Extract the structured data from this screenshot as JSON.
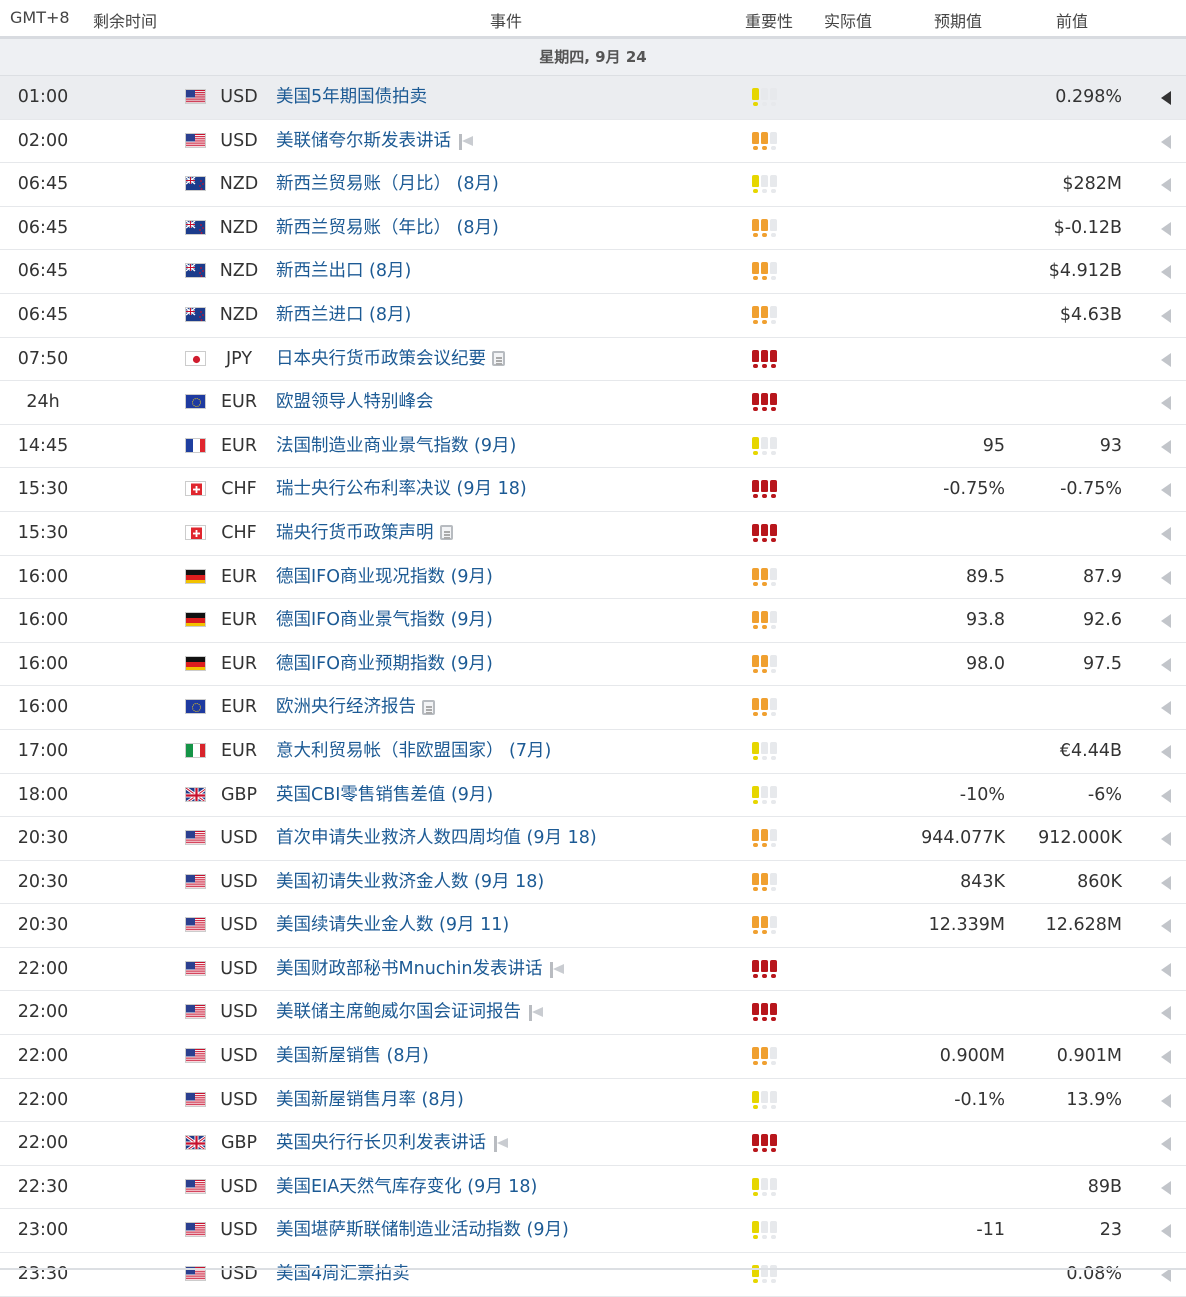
{
  "header": {
    "timezone": "GMT+8",
    "remaining": "剩余时间",
    "event": "事件",
    "importance": "重要性",
    "actual": "实际值",
    "forecast": "预期值",
    "previous": "前值"
  },
  "day_label": "星期四, 9月 24",
  "colors": {
    "link": "#1c5a94",
    "imp_low": "#e6d600",
    "imp_medium": "#f0a030",
    "imp_high": "#b8161c",
    "header_border": "#d8dbe0"
  },
  "events": [
    {
      "time": "01:00",
      "flag": "us",
      "currency": "USD",
      "name": "美国5年期国债拍卖",
      "icon": "",
      "importance": 1,
      "actual": "",
      "forecast": "",
      "previous": "0.298%",
      "highlighted": true
    },
    {
      "time": "02:00",
      "flag": "us",
      "currency": "USD",
      "name": "美联储夸尔斯发表讲话",
      "icon": "speech-icon",
      "importance": 2,
      "actual": "",
      "forecast": "",
      "previous": ""
    },
    {
      "time": "06:45",
      "flag": "nz",
      "currency": "NZD",
      "name": "新西兰贸易账（月比） (8月)",
      "icon": "",
      "importance": 1,
      "actual": "",
      "forecast": "",
      "previous": "$282M"
    },
    {
      "time": "06:45",
      "flag": "nz",
      "currency": "NZD",
      "name": "新西兰贸易账（年比） (8月)",
      "icon": "",
      "importance": 2,
      "actual": "",
      "forecast": "",
      "previous": "$-0.12B"
    },
    {
      "time": "06:45",
      "flag": "nz",
      "currency": "NZD",
      "name": "新西兰出口 (8月)",
      "icon": "",
      "importance": 2,
      "actual": "",
      "forecast": "",
      "previous": "$4.912B"
    },
    {
      "time": "06:45",
      "flag": "nz",
      "currency": "NZD",
      "name": "新西兰进口 (8月)",
      "icon": "",
      "importance": 2,
      "actual": "",
      "forecast": "",
      "previous": "$4.63B"
    },
    {
      "time": "07:50",
      "flag": "jp",
      "currency": "JPY",
      "name": "日本央行货币政策会议纪要",
      "icon": "report-icon",
      "importance": 3,
      "actual": "",
      "forecast": "",
      "previous": ""
    },
    {
      "time": "24h",
      "flag": "eu",
      "currency": "EUR",
      "name": "欧盟领导人特别峰会",
      "icon": "",
      "importance": 3,
      "actual": "",
      "forecast": "",
      "previous": ""
    },
    {
      "time": "14:45",
      "flag": "fr",
      "currency": "EUR",
      "name": "法国制造业商业景气指数 (9月)",
      "icon": "",
      "importance": 1,
      "actual": "",
      "forecast": "95",
      "previous": "93"
    },
    {
      "time": "15:30",
      "flag": "ch",
      "currency": "CHF",
      "name": "瑞士央行公布利率决议 (9月 18)",
      "icon": "",
      "importance": 3,
      "actual": "",
      "forecast": "-0.75%",
      "previous": "-0.75%"
    },
    {
      "time": "15:30",
      "flag": "ch",
      "currency": "CHF",
      "name": "瑞央行货币政策声明",
      "icon": "report-icon",
      "importance": 3,
      "actual": "",
      "forecast": "",
      "previous": ""
    },
    {
      "time": "16:00",
      "flag": "de",
      "currency": "EUR",
      "name": "德国IFO商业现况指数 (9月)",
      "icon": "",
      "importance": 2,
      "actual": "",
      "forecast": "89.5",
      "previous": "87.9"
    },
    {
      "time": "16:00",
      "flag": "de",
      "currency": "EUR",
      "name": "德国IFO商业景气指数 (9月)",
      "icon": "",
      "importance": 2,
      "actual": "",
      "forecast": "93.8",
      "previous": "92.6"
    },
    {
      "time": "16:00",
      "flag": "de",
      "currency": "EUR",
      "name": "德国IFO商业预期指数 (9月)",
      "icon": "",
      "importance": 2,
      "actual": "",
      "forecast": "98.0",
      "previous": "97.5"
    },
    {
      "time": "16:00",
      "flag": "eu",
      "currency": "EUR",
      "name": "欧洲央行经济报告",
      "icon": "report-icon",
      "importance": 2,
      "actual": "",
      "forecast": "",
      "previous": ""
    },
    {
      "time": "17:00",
      "flag": "it",
      "currency": "EUR",
      "name": "意大利贸易帐（非欧盟国家） (7月)",
      "icon": "",
      "importance": 1,
      "actual": "",
      "forecast": "",
      "previous": "€4.44B"
    },
    {
      "time": "18:00",
      "flag": "gb",
      "currency": "GBP",
      "name": "英国CBI零售销售差值 (9月)",
      "icon": "",
      "importance": 1,
      "actual": "",
      "forecast": "-10%",
      "previous": "-6%"
    },
    {
      "time": "20:30",
      "flag": "us",
      "currency": "USD",
      "name": "首次申请失业救济人数四周均值 (9月 18)",
      "icon": "",
      "importance": 2,
      "actual": "",
      "forecast": "944.077K",
      "previous": "912.000K"
    },
    {
      "time": "20:30",
      "flag": "us",
      "currency": "USD",
      "name": "美国初请失业救济金人数 (9月 18)",
      "icon": "",
      "importance": 2,
      "actual": "",
      "forecast": "843K",
      "previous": "860K"
    },
    {
      "time": "20:30",
      "flag": "us",
      "currency": "USD",
      "name": "美国续请失业金人数 (9月 11)",
      "icon": "",
      "importance": 2,
      "actual": "",
      "forecast": "12.339M",
      "previous": "12.628M"
    },
    {
      "time": "22:00",
      "flag": "us",
      "currency": "USD",
      "name": "美国财政部秘书Mnuchin发表讲话",
      "icon": "speech-icon",
      "importance": 3,
      "actual": "",
      "forecast": "",
      "previous": ""
    },
    {
      "time": "22:00",
      "flag": "us",
      "currency": "USD",
      "name": "美联储主席鲍威尔国会证词报告",
      "icon": "speech-icon",
      "importance": 3,
      "actual": "",
      "forecast": "",
      "previous": ""
    },
    {
      "time": "22:00",
      "flag": "us",
      "currency": "USD",
      "name": "美国新屋销售 (8月)",
      "icon": "",
      "importance": 2,
      "actual": "",
      "forecast": "0.900M",
      "previous": "0.901M"
    },
    {
      "time": "22:00",
      "flag": "us",
      "currency": "USD",
      "name": "美国新屋销售月率 (8月)",
      "icon": "",
      "importance": 1,
      "actual": "",
      "forecast": "-0.1%",
      "previous": "13.9%"
    },
    {
      "time": "22:00",
      "flag": "gb",
      "currency": "GBP",
      "name": "英国央行行长贝利发表讲话",
      "icon": "speech-icon",
      "importance": 3,
      "actual": "",
      "forecast": "",
      "previous": ""
    },
    {
      "time": "22:30",
      "flag": "us",
      "currency": "USD",
      "name": "美国EIA天然气库存变化 (9月 18)",
      "icon": "",
      "importance": 1,
      "actual": "",
      "forecast": "",
      "previous": "89B"
    },
    {
      "time": "23:00",
      "flag": "us",
      "currency": "USD",
      "name": "美国堪萨斯联储制造业活动指数 (9月)",
      "icon": "",
      "importance": 1,
      "actual": "",
      "forecast": "-11",
      "previous": "23"
    },
    {
      "time": "23:30",
      "flag": "us",
      "currency": "USD",
      "name": "美国4周汇票拍卖",
      "icon": "",
      "importance": 1,
      "actual": "",
      "forecast": "",
      "previous": "0.08%"
    }
  ]
}
